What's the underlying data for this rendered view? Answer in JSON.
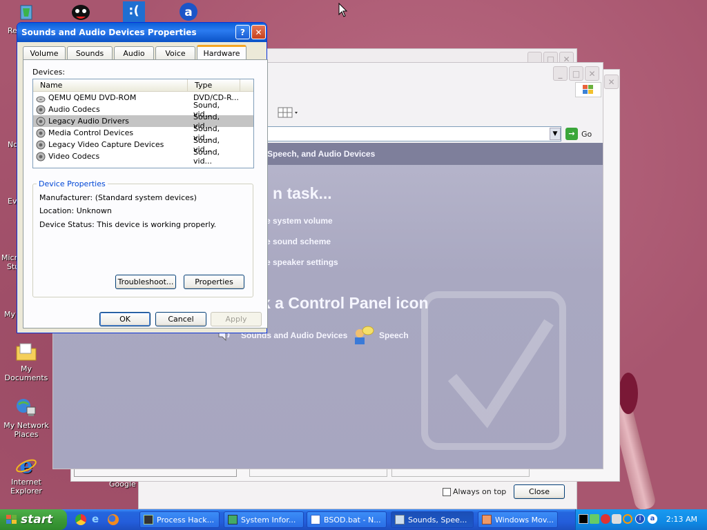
{
  "desktop": {
    "icons": [
      {
        "label": "My Documents"
      },
      {
        "label": "My Network Places"
      },
      {
        "label": "Internet Explorer"
      }
    ],
    "partial_labels": [
      "Re",
      "No",
      "Ev",
      "Micro",
      "Stu",
      "My",
      "Google C"
    ]
  },
  "control_panel": {
    "address_go": "Go",
    "header": "Speech, and Audio Devices",
    "pick_task": "n task...",
    "tasks": [
      "e system volume",
      "e sound scheme",
      "e speaker settings"
    ],
    "pick_icon": "k a Control Panel icon",
    "icons": [
      "Sounds and Audio Devices",
      "Speech"
    ]
  },
  "process_window": {
    "always_on_top": "Always on top",
    "close": "Close"
  },
  "dialog": {
    "title": "Sounds and Audio Devices Properties",
    "help_btn": "?",
    "close_btn": "✕",
    "tabs": [
      "Volume",
      "Sounds",
      "Audio",
      "Voice",
      "Hardware"
    ],
    "active_tab": "Hardware",
    "devices_label": "Devices:",
    "columns": [
      "Name",
      "Type"
    ],
    "devices": [
      {
        "name": "QEMU QEMU DVD-ROM",
        "type": "DVD/CD-R..."
      },
      {
        "name": "Audio Codecs",
        "type": "Sound, vid..."
      },
      {
        "name": "Legacy Audio Drivers",
        "type": "Sound, vid..."
      },
      {
        "name": "Media Control Devices",
        "type": "Sound, vid..."
      },
      {
        "name": "Legacy Video Capture Devices",
        "type": "Sound, vid..."
      },
      {
        "name": "Video Codecs",
        "type": "Sound, vid..."
      }
    ],
    "selected_row": 2,
    "device_properties_label": "Device Properties",
    "manufacturer": "Manufacturer: (Standard system devices)",
    "location": "Location: Unknown",
    "status": "Device Status: This device is working properly.",
    "troubleshoot_btn": "Troubleshoot...",
    "properties_btn": "Properties",
    "ok_btn": "OK",
    "cancel_btn": "Cancel",
    "apply_btn": "Apply"
  },
  "taskbar": {
    "start": "start",
    "items": [
      {
        "label": "Process Hack..."
      },
      {
        "label": "System Infor..."
      },
      {
        "label": "BSOD.bat - N..."
      },
      {
        "label": "Sounds, Spee..."
      },
      {
        "label": "Windows Mov..."
      }
    ],
    "active_item": 3,
    "clock": "2:13 AM"
  }
}
